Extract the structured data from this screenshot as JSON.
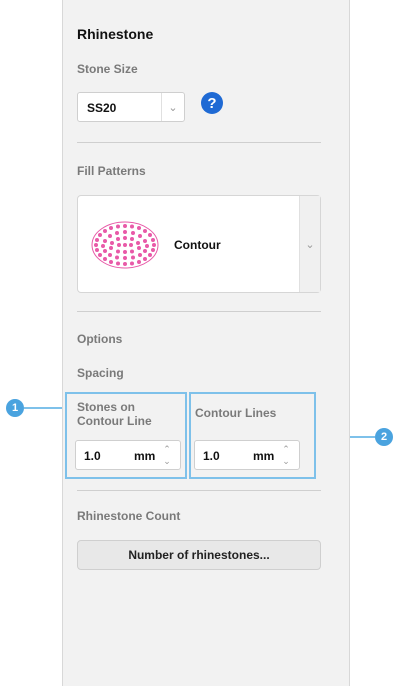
{
  "panel": {
    "title": "Rhinestone",
    "stone_size": {
      "label": "Stone Size",
      "value": "SS20"
    },
    "help_icon": "?",
    "fill_patterns": {
      "label": "Fill Patterns",
      "selected": "Contour"
    },
    "options": {
      "label": "Options",
      "spacing_label": "Spacing",
      "stones_on_contour": {
        "label_line1": "Stones on",
        "label_line2": "Contour Line",
        "value": "1.0",
        "unit": "mm"
      },
      "contour_lines": {
        "label": "Contour Lines",
        "value": "1.0",
        "unit": "mm"
      }
    },
    "count": {
      "label": "Rhinestone Count",
      "button": "Number of rhinestones..."
    }
  },
  "callouts": [
    "1",
    "2"
  ],
  "colors": {
    "accent": "#1f6ad4",
    "highlight": "#7ec1ea",
    "callout": "#4aa3df",
    "stone": "#e85aa8"
  }
}
